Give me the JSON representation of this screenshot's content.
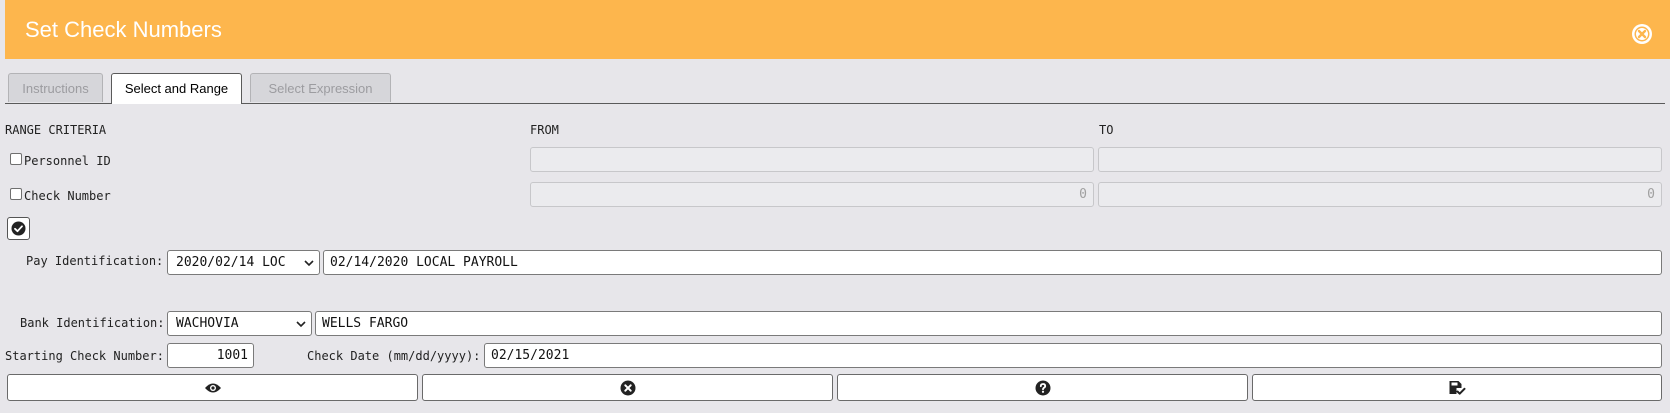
{
  "window": {
    "title": "Set Check Numbers",
    "close_icon": "close-circle-icon"
  },
  "tabs": [
    {
      "label": "Instructions",
      "active": false
    },
    {
      "label": "Select and Range",
      "active": true
    },
    {
      "label": "Select Expression",
      "active": false
    }
  ],
  "range": {
    "criteria_header": "RANGE CRITERIA",
    "from_header": "FROM",
    "to_header": "TO",
    "rows": [
      {
        "label": "Personnel ID",
        "checked": false,
        "from": "",
        "to": ""
      },
      {
        "label": "Check Number",
        "checked": false,
        "from": "0",
        "to": "0"
      }
    ],
    "apply_icon": "check-circle-icon"
  },
  "pay": {
    "label": "Pay Identification:",
    "selected": "2020/02/14 LOC",
    "description": "02/14/2020 LOCAL PAYROLL"
  },
  "bank": {
    "label": "Bank Identification:",
    "selected": "WACHOVIA",
    "description": "WELLS FARGO"
  },
  "starting_check": {
    "label": "Starting Check Number:",
    "value": "1001"
  },
  "check_date": {
    "label": "Check Date (mm/dd/yyyy):",
    "value": "02/15/2021"
  },
  "buttons": [
    {
      "icon": "eye-icon"
    },
    {
      "icon": "close-circle-icon"
    },
    {
      "icon": "question-circle-icon"
    },
    {
      "icon": "save-check-icon"
    }
  ],
  "colors": {
    "header": "#fdb64d",
    "background": "#e7e6ea"
  }
}
